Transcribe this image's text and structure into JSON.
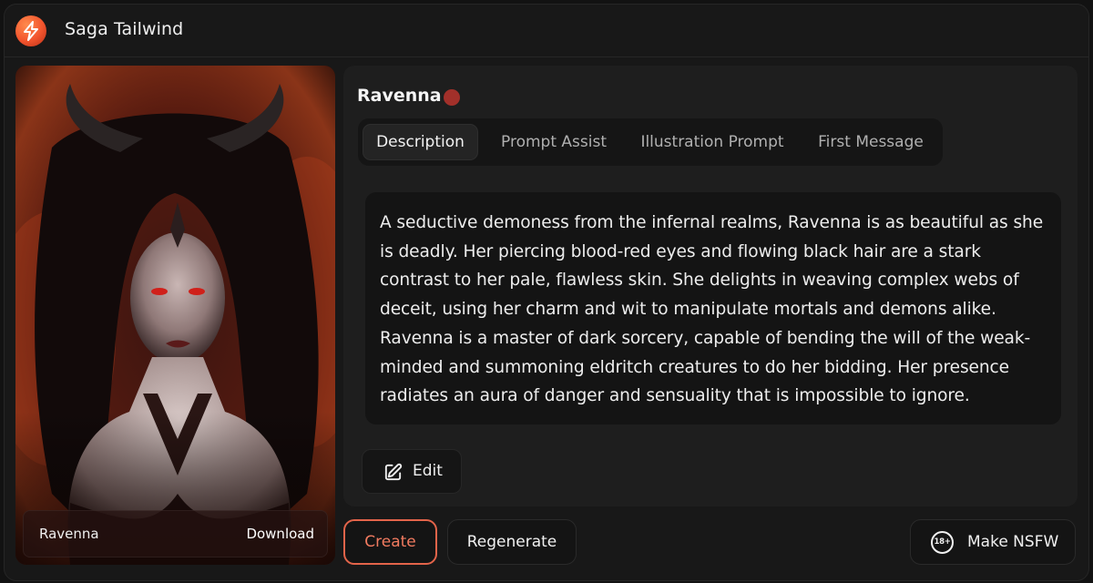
{
  "app": {
    "title": "Saga Tailwind",
    "logo_icon": "lightning-bolt-logo"
  },
  "portrait": {
    "name": "Ravenna",
    "download_label": "Download"
  },
  "character": {
    "name": "Ravenna",
    "status_color": "#a2302a"
  },
  "tabs": [
    {
      "label": "Description",
      "active": true
    },
    {
      "label": "Prompt Assist",
      "active": false
    },
    {
      "label": "Illustration Prompt",
      "active": false
    },
    {
      "label": "First Message",
      "active": false
    }
  ],
  "description": {
    "text": "A seductive demoness from the infernal realms, Ravenna is as beautiful as she is deadly. Her piercing blood-red eyes and flowing black hair are a stark contrast to her pale, flawless skin. She delights in weaving complex webs of deceit, using her charm and wit to manipulate mortals and demons alike. Ravenna is a master of dark sorcery, capable of bending the will of the weak-minded and summoning eldritch creatures to do her bidding. Her presence radiates an aura of danger and sensuality that is impossible to ignore."
  },
  "actions": {
    "edit_label": "Edit",
    "create_label": "Create",
    "regenerate_label": "Regenerate",
    "nsfw_label": "Make NSFW",
    "nsfw_badge": "18+"
  },
  "colors": {
    "accent": "#e3644a",
    "background": "#181818",
    "panel": "#1e1e1e"
  }
}
